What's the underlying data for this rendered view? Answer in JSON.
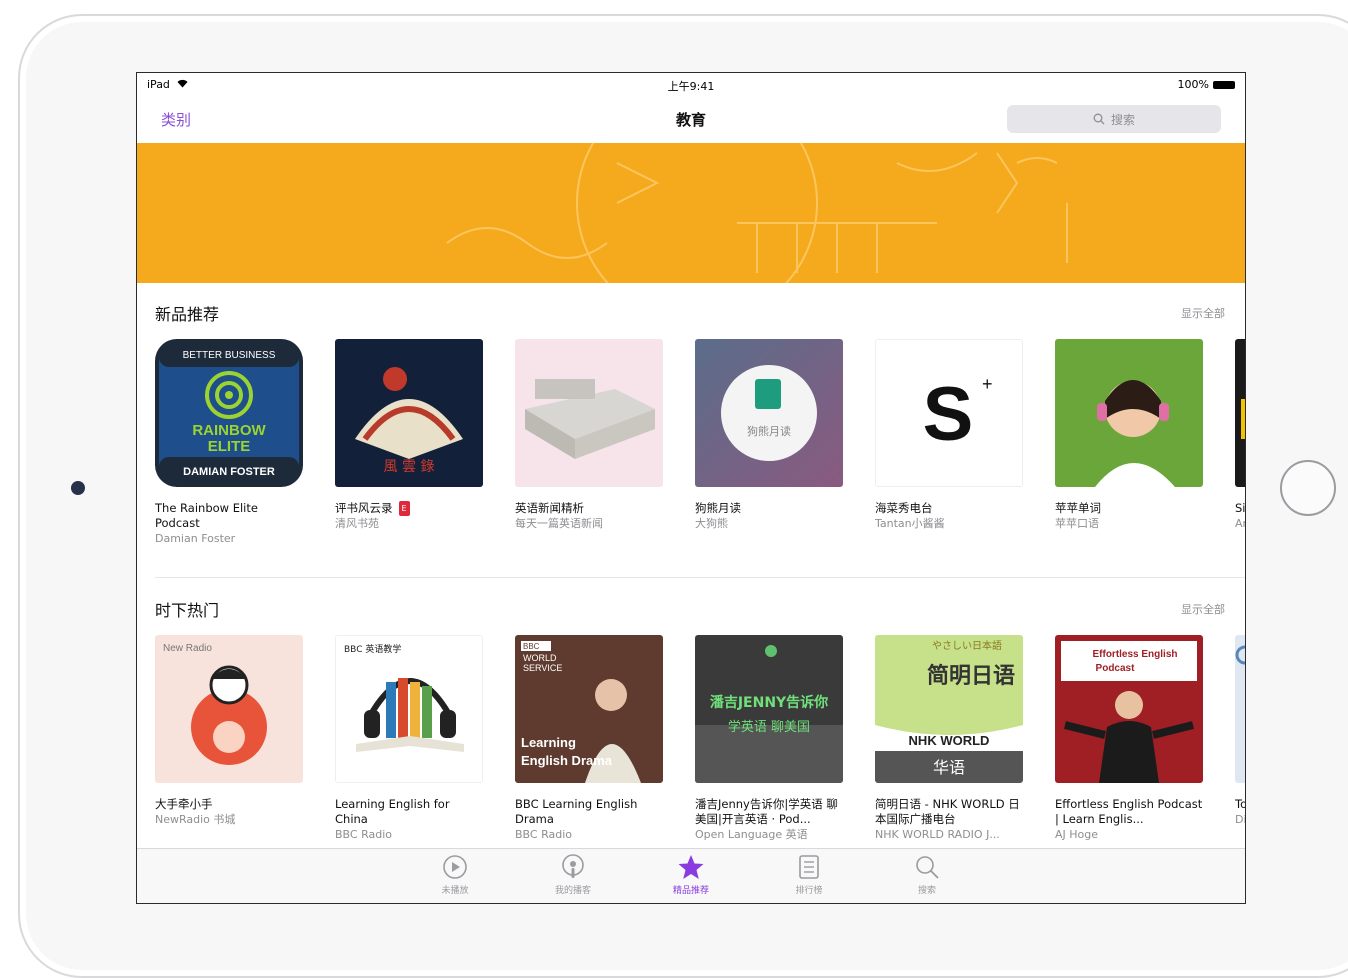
{
  "status_bar": {
    "carrier": "iPad",
    "time": "上午9:41",
    "battery": "100%"
  },
  "nav": {
    "back_label": "类别",
    "title": "教育",
    "search_placeholder": "搜索"
  },
  "sections": [
    {
      "title": "新品推荐",
      "more": "显示全部",
      "items": [
        {
          "title": "The Rainbow Elite Podcast",
          "subtitle": "Damian Foster",
          "art_text": [
            "BETTER BUSINESS",
            "RAINBOW",
            "ELITE",
            "DAMIAN FOSTER"
          ]
        },
        {
          "title": "评书风云录",
          "badge": "E",
          "subtitle": "清风书苑"
        },
        {
          "title": "英语新闻精析",
          "subtitle": "每天一篇英语新闻"
        },
        {
          "title": "狗熊月读",
          "subtitle": "大狗熊",
          "art_text": [
            "狗熊月读"
          ]
        },
        {
          "title": "海菜秀电台",
          "subtitle": "Tantan小酱酱",
          "art_text": [
            "S"
          ]
        },
        {
          "title": "苹苹单词",
          "subtitle": "苹苹口语"
        },
        {
          "title": "Si",
          "subtitle": "Ar"
        }
      ]
    },
    {
      "title": "时下热门",
      "more": "显示全部",
      "items": [
        {
          "title": "大手牵小手",
          "subtitle": "NewRadio 书城",
          "art_text": [
            "New Radio"
          ]
        },
        {
          "title": "Learning English for China",
          "subtitle": "BBC Radio",
          "art_text": [
            "BBC 英语教学"
          ]
        },
        {
          "title": "BBC Learning English Drama",
          "subtitle": "BBC Radio",
          "art_text": [
            "BBC",
            "WORLD",
            "SERVICE",
            "Learning",
            "English Drama"
          ]
        },
        {
          "title": "潘吉Jenny告诉你|学英语 聊美国|开言英语 · Pod...",
          "subtitle": "Open Language 英语",
          "art_text": [
            "潘吉JENNY告诉你",
            "学英语 聊美国"
          ]
        },
        {
          "title": "简明日语 - NHK WORLD 日本国际广播电台",
          "subtitle": "NHK WORLD RADIO J...",
          "art_text": [
            "やさしい日本語",
            "简明日语",
            "NHK WORLD",
            "华语"
          ]
        },
        {
          "title": "Effortless English Podcast | Learn Englis...",
          "subtitle": "AJ Hoge",
          "art_text": [
            "Effortless English",
            "Podcast"
          ]
        },
        {
          "title": "To Vo",
          "subtitle": "Di"
        }
      ]
    }
  ],
  "tabs": [
    {
      "label": "未播放",
      "icon": "play-circle-icon",
      "active": false
    },
    {
      "label": "我的播客",
      "icon": "podcast-icon",
      "active": false
    },
    {
      "label": "精品推荐",
      "icon": "star-icon",
      "active": true
    },
    {
      "label": "排行榜",
      "icon": "list-icon",
      "active": false
    },
    {
      "label": "搜索",
      "icon": "search-icon",
      "active": false
    }
  ],
  "colors": {
    "accent": "#8a3be0",
    "banner": "#f5a91d"
  }
}
